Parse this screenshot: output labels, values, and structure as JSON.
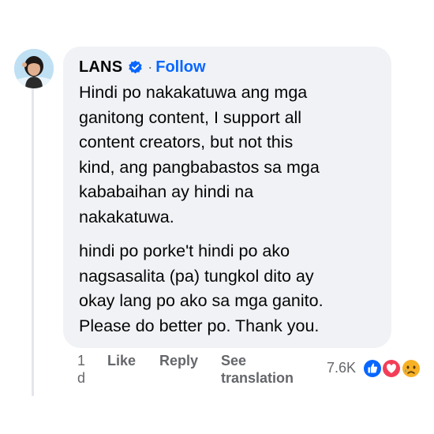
{
  "comment": {
    "author": "LANS",
    "verified_icon": "verified-badge-icon",
    "separator": "·",
    "follow_label": "Follow",
    "paragraphs": [
      "Hindi po nakakatuwa ang mga\nganitong content, I support all\ncontent creators, but not this\nkind, ang pangbabastos sa mga\nkababaihan ay hindi na\nnakakatuwa.",
      "hindi po porke't hindi po ako\nnagsasalita (pa) tungkol dito ay\nokay lang po ako sa mga ganito.\nPlease do better po. Thank you."
    ]
  },
  "actions": {
    "timestamp": "1 d",
    "like_label": "Like",
    "reply_label": "Reply",
    "translate_label": "See translation",
    "reaction_count": "7.6K",
    "reactions": [
      "like-icon",
      "love-icon",
      "sad-icon"
    ]
  },
  "colors": {
    "accent": "#0866ff",
    "bubble": "#f0f2f5",
    "muted": "#65676b",
    "love": "#f33e58",
    "sad": "#f7b125"
  }
}
